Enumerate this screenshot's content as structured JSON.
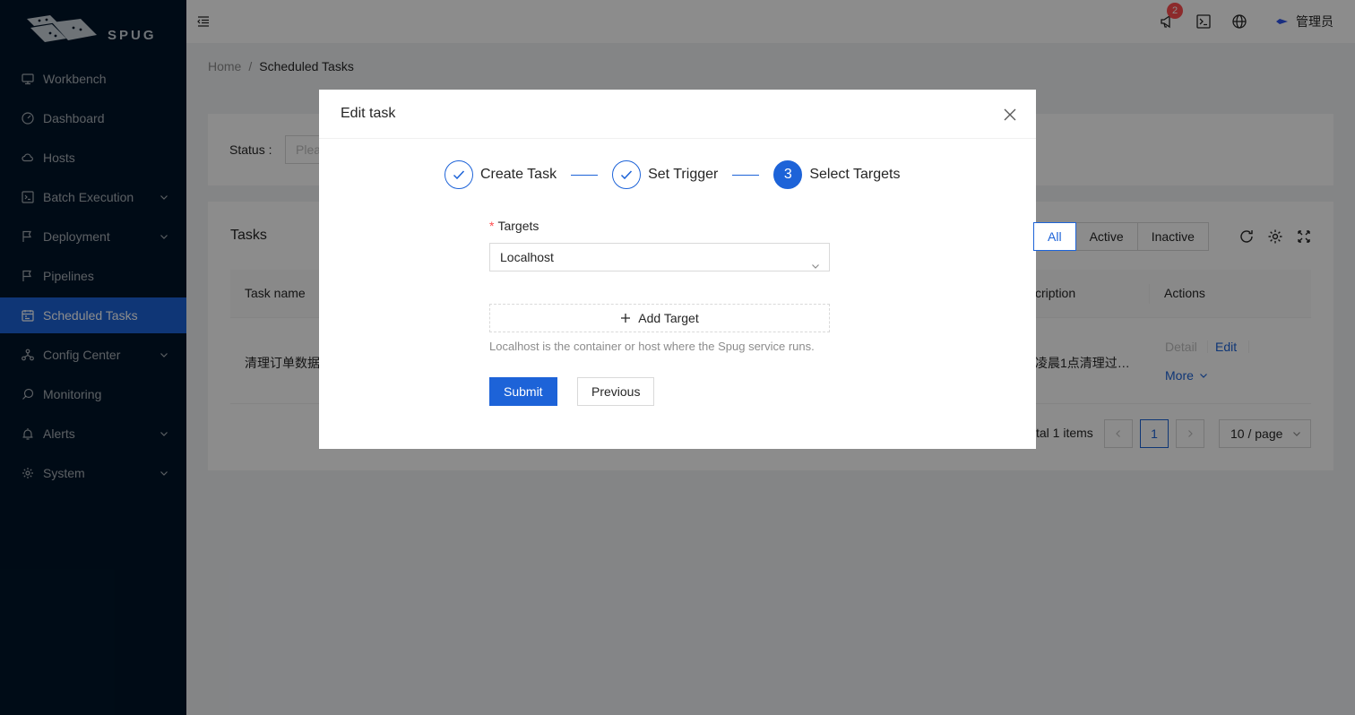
{
  "app": {
    "logo_text": "SPUG"
  },
  "sidebar": {
    "items": [
      {
        "label": "Workbench"
      },
      {
        "label": "Dashboard"
      },
      {
        "label": "Hosts"
      },
      {
        "label": "Batch Execution"
      },
      {
        "label": "Deployment"
      },
      {
        "label": "Pipelines"
      },
      {
        "label": "Scheduled Tasks"
      },
      {
        "label": "Config Center"
      },
      {
        "label": "Monitoring"
      },
      {
        "label": "Alerts"
      },
      {
        "label": "System"
      }
    ]
  },
  "header": {
    "notification_count": "2",
    "username": "管理员"
  },
  "breadcrumb": {
    "home": "Home",
    "separator": "/",
    "current": "Scheduled Tasks"
  },
  "filter": {
    "status_label": "Status :",
    "status_placeholder": "Plea"
  },
  "table": {
    "title": "Tasks",
    "segments": [
      "All",
      "Active",
      "Inactive"
    ],
    "columns": {
      "task_name": "Task name",
      "description": "cription",
      "actions": "Actions"
    },
    "row": {
      "task_name": "清理订单数据",
      "description": "凌晨1点清理过…",
      "detail": "Detail",
      "edit": "Edit",
      "more": "More"
    },
    "pagination": {
      "total": "tal 1 items",
      "current_page": "1",
      "page_size": "10 / page"
    }
  },
  "modal": {
    "title": "Edit task",
    "steps": [
      {
        "title": "Create Task",
        "status": "finish"
      },
      {
        "title": "Set Trigger",
        "status": "finish"
      },
      {
        "title": "Select Targets",
        "status": "process",
        "number": "3"
      }
    ],
    "form": {
      "targets_label": "Targets",
      "targets_value": "Localhost",
      "add_target_label": "Add Target",
      "hint": "Localhost is the container or host where the Spug service runs.",
      "submit_label": "Submit",
      "previous_label": "Previous"
    }
  },
  "colors": {
    "primary": "#1d63d8",
    "sidebar_bg": "#001529",
    "danger": "#ff4d4f"
  }
}
